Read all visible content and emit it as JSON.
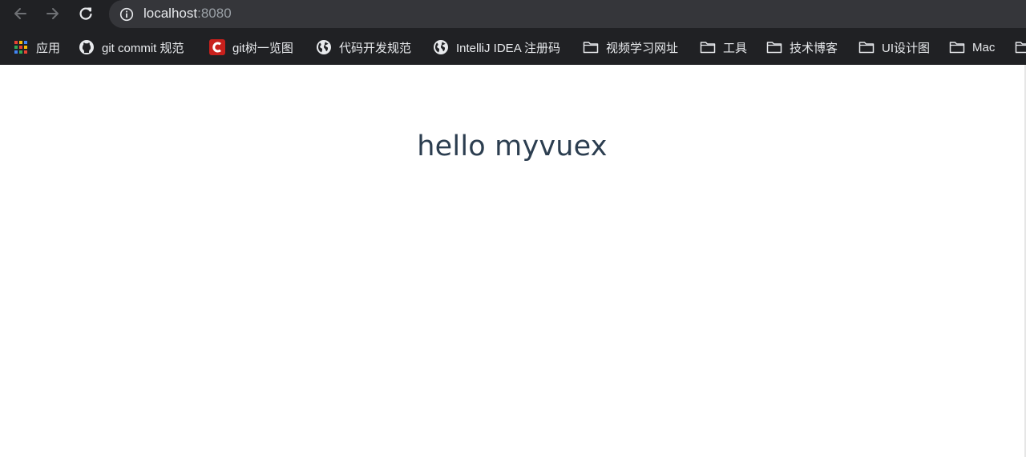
{
  "address_bar": {
    "host": "localhost",
    "port": ":8080"
  },
  "bookmarks": [
    {
      "label": "应用",
      "icon": "apps-grid-icon"
    },
    {
      "label": "git commit 规范",
      "icon": "github-icon"
    },
    {
      "label": "git树一览图",
      "icon": "csdn-icon"
    },
    {
      "label": "代码开发规范",
      "icon": "globe-icon"
    },
    {
      "label": "IntelliJ IDEA 注册码",
      "icon": "globe-icon"
    },
    {
      "label": "视频学习网址",
      "icon": "folder-icon"
    },
    {
      "label": "工具",
      "icon": "folder-icon"
    },
    {
      "label": "技术博客",
      "icon": "folder-icon"
    },
    {
      "label": "UI设计图",
      "icon": "folder-icon"
    },
    {
      "label": "Mac",
      "icon": "folder-icon"
    }
  ],
  "page": {
    "message": "hello myvuex"
  },
  "colors": {
    "browser_frame": "#202124",
    "omnibox": "#35363a",
    "toolbar_text": "#e8eaed",
    "port_text": "#9aa0a6",
    "message_text": "#2c3e50",
    "csdn_red": "#c8201c"
  }
}
